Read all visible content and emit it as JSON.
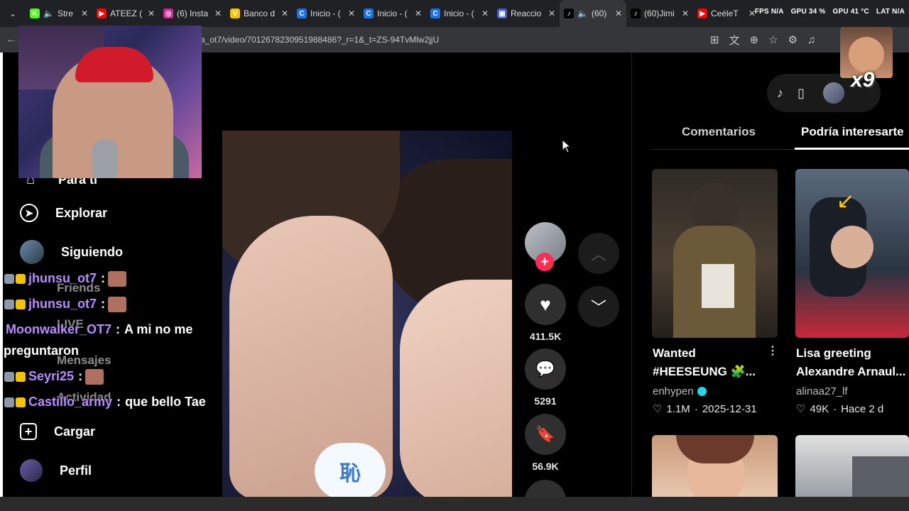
{
  "tabs": [
    {
      "label": "Stre",
      "favicon_color": "#53fc18",
      "favicon_glyph": "K",
      "speaker": true
    },
    {
      "label": "ATEEZ (",
      "favicon_color": "#ff0000",
      "favicon_glyph": "▶"
    },
    {
      "label": "(6) Insta",
      "favicon_color": "#d6249f",
      "favicon_glyph": "◎"
    },
    {
      "label": "Banco d",
      "favicon_color": "#f5c400",
      "favicon_glyph": "V"
    },
    {
      "label": "Inicio - (",
      "favicon_color": "#1a73e8",
      "favicon_glyph": "C"
    },
    {
      "label": "Inicio - (",
      "favicon_color": "#1a73e8",
      "favicon_glyph": "C"
    },
    {
      "label": "Inicio - (",
      "favicon_color": "#1a73e8",
      "favicon_glyph": "C"
    },
    {
      "label": "Reaccio",
      "favicon_color": "#4b5bd8",
      "favicon_glyph": "▣"
    },
    {
      "label": "(60)",
      "favicon_color": "#000000",
      "favicon_glyph": "♪",
      "speaker": true,
      "active": true
    },
    {
      "label": "(60)Jimi",
      "favicon_color": "#000000",
      "favicon_glyph": "♪"
    },
    {
      "label": "CeéleT",
      "favicon_color": "#ff0000",
      "favicon_glyph": "▶"
    }
  ],
  "overlay_stats": {
    "fps": "FPS N/A",
    "gpu": "GPU 34 %",
    "gpu_temp": "GPU 41 °C",
    "lat": "LAT N/A"
  },
  "address": {
    "url": "a_ot7/video/7012678230951988486?_r=1&_t=ZS-94TvMlw2jjU"
  },
  "sidebar": {
    "items": [
      {
        "label": "Para ti",
        "icon": "home-icon"
      },
      {
        "label": "Explorar",
        "icon": "compass-icon"
      },
      {
        "label": "Siguiendo",
        "icon": "avatar-icon"
      },
      {
        "label": "Friends",
        "icon": "friends-icon"
      },
      {
        "label": "LIVE",
        "icon": "live-icon"
      },
      {
        "label": "Mensajes",
        "icon": "messages-icon"
      },
      {
        "label": "Actividad",
        "icon": "activity-icon"
      },
      {
        "label": "Cargar",
        "icon": "upload-icon"
      },
      {
        "label": "Perfil",
        "icon": "profile-icon"
      }
    ]
  },
  "chat": [
    {
      "user": "jhunsu_ot7",
      "sep": ":",
      "message": "",
      "emote": true,
      "user_color": "#b88cff"
    },
    {
      "user": "jhunsu_ot7",
      "sep": ":",
      "message": "",
      "emote": true,
      "user_color": "#b88cff"
    },
    {
      "user": "Moonwalker_OT7",
      "sep": ":",
      "message": "A mi no me",
      "user_color": "#b88cff"
    },
    {
      "user": "",
      "sep": "",
      "message": "preguntaron",
      "user_color": "#b88cff"
    },
    {
      "user": "Seyri25",
      "sep": ":",
      "message": "",
      "emote": true,
      "user_color": "#b88cff"
    },
    {
      "user": "Castillo_army",
      "sep": ":",
      "message": "que bello Tae",
      "user_color": "#b88cff"
    }
  ],
  "video": {
    "sticker_text": "恥"
  },
  "actions": {
    "likes": "411.5K",
    "comments": "5291",
    "saves": "56.9K"
  },
  "right_panel": {
    "tabs": [
      "Comentarios",
      "Podría interesarte"
    ],
    "active_tab": 1,
    "cards": [
      {
        "title1": "Wanted",
        "title2": "#HEESEUNG 🧩...",
        "author": "enhypen",
        "verified": true,
        "likes": "1.1M",
        "date": "2025-12-31"
      },
      {
        "title1": "Lisa greeting",
        "title2": "Alexandre Arnaul...",
        "author": "alinaa27_lf",
        "verified": false,
        "likes": "49K",
        "date": "Hace 2 d"
      }
    ]
  },
  "reaction_overlay": {
    "text": "x9"
  },
  "colors": {
    "accent": "#fe2c55",
    "verified": "#20d5ec"
  }
}
